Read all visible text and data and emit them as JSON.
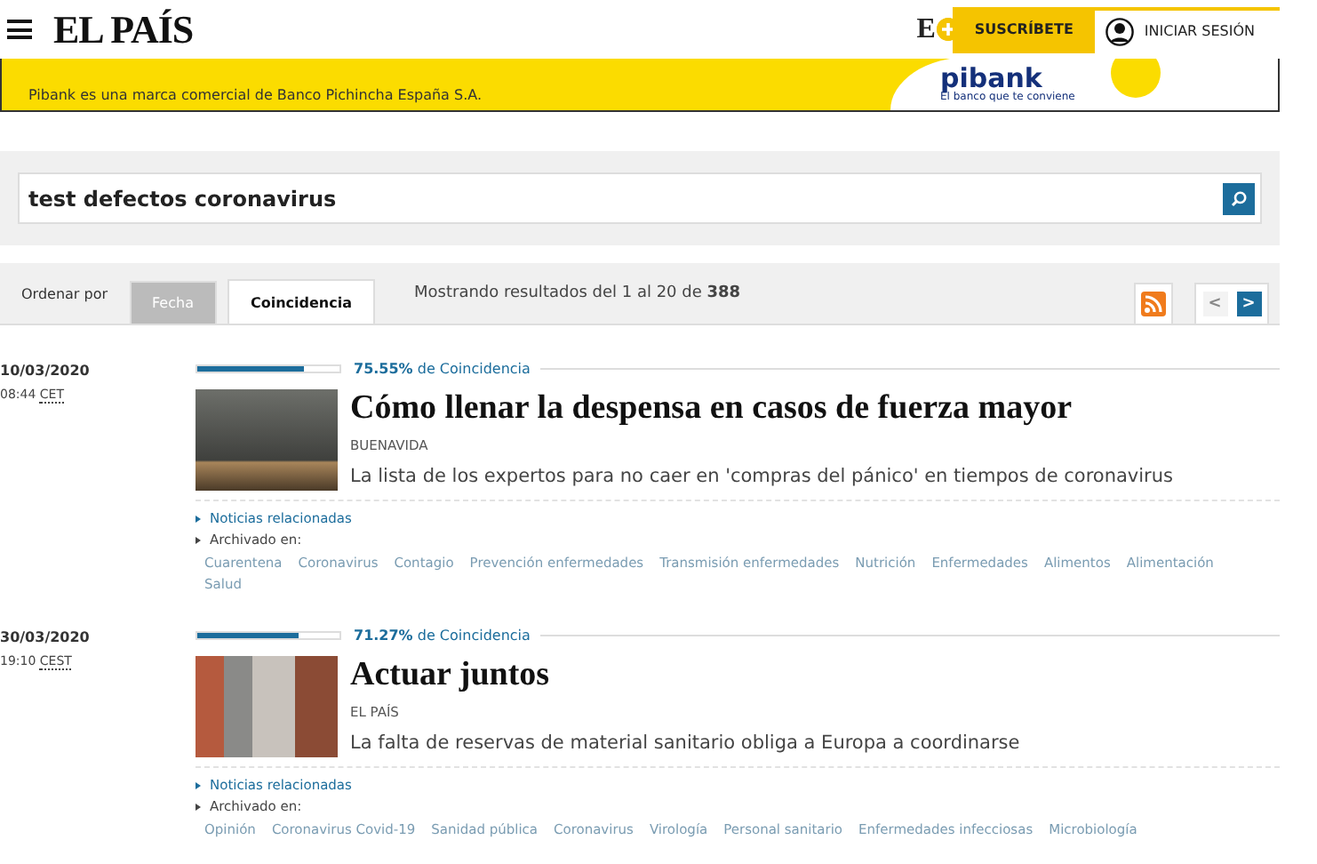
{
  "header": {
    "logo": "EL PAÍS",
    "premium_mark": "E",
    "subscribe": "SUSCRÍBETE",
    "login": "INICIAR SESIÓN"
  },
  "banner": {
    "text": "Pibank es una marca comercial de Banco Pichincha España S.A.",
    "brand": "pibank",
    "slogan": "El banco que te conviene"
  },
  "search": {
    "value": "test defectos coronavirus"
  },
  "sort": {
    "label": "Ordenar por",
    "options": [
      {
        "label": "Fecha",
        "selected": false
      },
      {
        "label": "Coincidencia",
        "selected": true
      }
    ],
    "summary": "Mostrando resultados del 1 al 20 de **388**"
  },
  "pager": {
    "prev": "<",
    "next": ">",
    "prev_disabled": true
  },
  "results": [
    {
      "date": "10/03/2020",
      "time": "08:44",
      "zone": "CET",
      "level": 0.7555,
      "score": "75.55%",
      "score_label": "de Coincidencia",
      "title": "Cómo llenar la despensa en casos de fuerza mayor",
      "section": "BUENAVIDA",
      "summary": "La lista de los expertos para no caer en 'compras del pánico' en tiempos de coronavirus",
      "related": "Noticias relacionadas",
      "archived": "Archivado en:",
      "tags": [
        "Cuarentena",
        "Coronavirus",
        "Contagio",
        "Prevención enfermedades",
        "Transmisión enfermedades",
        "Nutrición",
        "Enfermedades",
        "Alimentos",
        "Alimentación",
        "Salud"
      ]
    },
    {
      "date": "30/03/2020",
      "time": "19:10",
      "zone": "CEST",
      "level": 0.7127,
      "score": "71.27%",
      "score_label": "de Coincidencia",
      "title": "Actuar juntos",
      "section": "EL PAÍS",
      "summary": "La falta de reservas de material sanitario obliga a Europa a coordinarse",
      "related": "Noticias relacionadas",
      "archived": "Archivado en:",
      "tags": [
        "Opinión",
        "Coronavirus Covid-19",
        "Sanidad pública",
        "Coronavirus",
        "Virología",
        "Personal sanitario",
        "Enfermedades infecciosas",
        "Microbiología"
      ]
    }
  ]
}
